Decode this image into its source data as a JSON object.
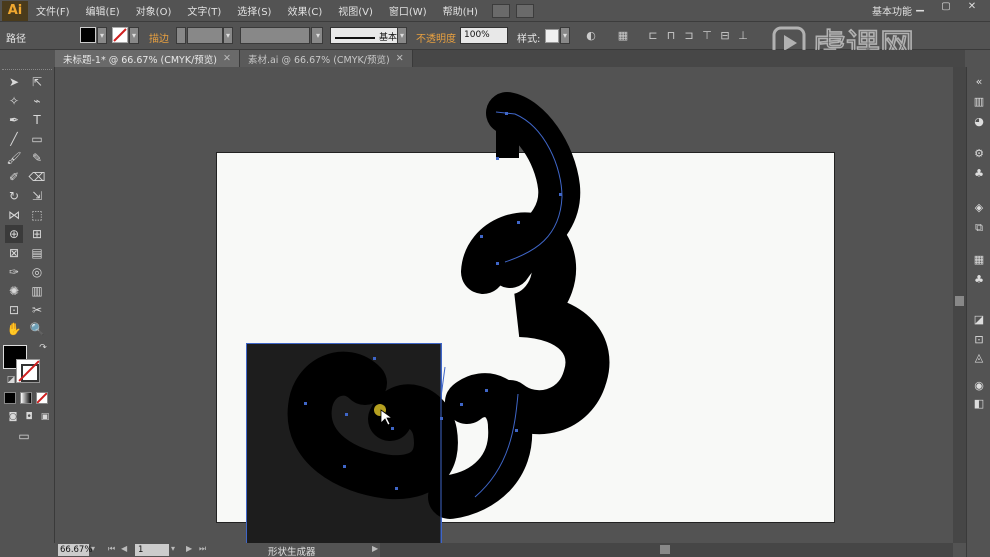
{
  "app": {
    "logo": "Ai"
  },
  "menu": [
    "文件(F)",
    "编辑(E)",
    "对象(O)",
    "文字(T)",
    "选择(S)",
    "效果(C)",
    "视图(V)",
    "窗口(W)",
    "帮助(H)"
  ],
  "workspace_label": "基本功能",
  "controlbar": {
    "path_label": "路径",
    "stroke_label": "描边",
    "brush_label": "基本",
    "opacity_label": "不透明度",
    "opacity_value": "100%",
    "style_label": "样式:"
  },
  "tabs": [
    {
      "label": "未标题-1* @ 66.67% (CMYK/预览)",
      "close": "✕"
    },
    {
      "label": "素材.ai @ 66.67% (CMYK/预览)",
      "close": "✕"
    }
  ],
  "status": {
    "zoom": "66.67%",
    "page": "1",
    "tool_name": "形状生成器"
  },
  "watermark": "虎课网",
  "colors": {
    "fill": "#000000",
    "stroke": "#ffffff",
    "selection": "#3f66c8",
    "artboard": "#f8f9f7",
    "cursor": "#b5a020"
  }
}
